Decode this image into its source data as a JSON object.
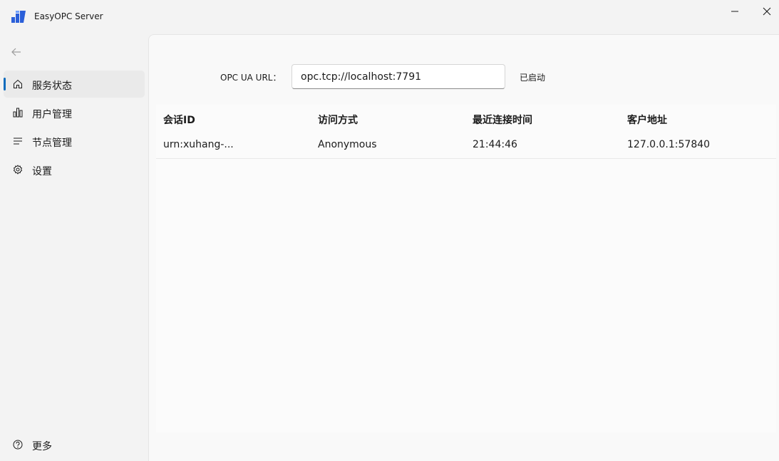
{
  "window": {
    "title": "EasyOPC Server",
    "accent_color": "#0f6cbd"
  },
  "sidebar": {
    "back_icon": "arrow-left-icon",
    "items": [
      {
        "label": "服务状态",
        "icon": "home-icon",
        "active": true
      },
      {
        "label": "用户管理",
        "icon": "bar-chart-icon",
        "active": false
      },
      {
        "label": "节点管理",
        "icon": "list-icon",
        "active": false
      },
      {
        "label": "设置",
        "icon": "gear-icon",
        "active": false
      }
    ],
    "footer_item": {
      "label": "更多",
      "icon": "help-icon"
    }
  },
  "main": {
    "url_label": "OPC UA URL：",
    "url_value": "opc.tcp://localhost:7791",
    "status": "已启动",
    "table": {
      "columns": [
        "会话ID",
        "访问方式",
        "最近连接时间",
        "客户地址"
      ],
      "rows": [
        [
          "urn:xuhang-...",
          "Anonymous",
          "21:44:46",
          "127.0.0.1:57840"
        ]
      ]
    }
  }
}
